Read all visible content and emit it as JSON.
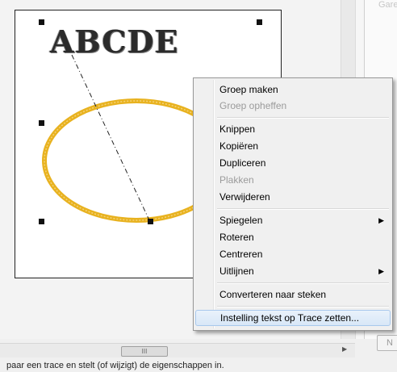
{
  "canvas": {
    "text_object": "ABCDE",
    "embroidery_color": "#e8b21f"
  },
  "right_panel": {
    "header_fragment": "Gare",
    "button_label": "N"
  },
  "scrollbar": {
    "thumb_grip": "III"
  },
  "status_bar": {
    "text": "paar een trace en stelt (of wijzigt) de eigenschappen in."
  },
  "context_menu": {
    "items": [
      {
        "label": "Groep maken",
        "enabled": true
      },
      {
        "label": "Groep opheffen",
        "enabled": false
      },
      {
        "label": "Knippen",
        "enabled": true
      },
      {
        "label": "Kopiëren",
        "enabled": true
      },
      {
        "label": "Dupliceren",
        "enabled": true
      },
      {
        "label": "Plakken",
        "enabled": false
      },
      {
        "label": "Verwijderen",
        "enabled": true
      },
      {
        "label": "Spiegelen",
        "enabled": true,
        "submenu": true
      },
      {
        "label": "Roteren",
        "enabled": true
      },
      {
        "label": "Centreren",
        "enabled": true
      },
      {
        "label": "Uitlijnen",
        "enabled": true,
        "submenu": true
      },
      {
        "label": "Converteren naar steken",
        "enabled": true
      },
      {
        "label": "Instelling tekst op Trace zetten...",
        "enabled": true,
        "highlighted": true
      }
    ]
  }
}
